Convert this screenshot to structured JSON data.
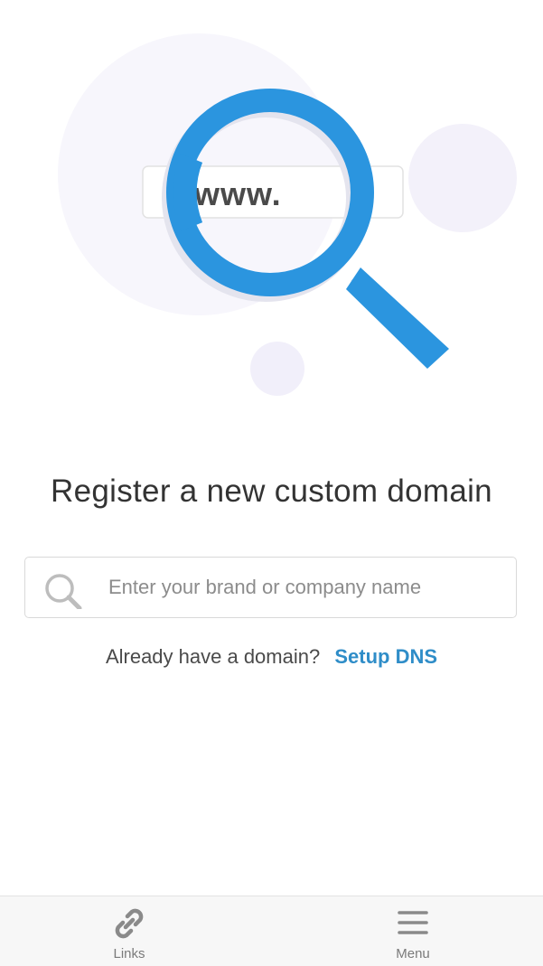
{
  "hero": {
    "url_text": "www.",
    "colors": {
      "magnifier": "#2b95df",
      "bubbles": "#f3f1fa"
    },
    "icon": "magnifier-illustration"
  },
  "main": {
    "title": "Register a new custom domain",
    "search": {
      "placeholder": "Enter your brand or company name",
      "value": "",
      "icon": "search-icon"
    },
    "dns_prompt": "Already have a domain?",
    "dns_link": "Setup DNS",
    "colors": {
      "link": "#2f8dc8"
    }
  },
  "bottom_nav": {
    "items": [
      {
        "label": "Links",
        "icon": "link-icon"
      },
      {
        "label": "Menu",
        "icon": "hamburger-menu-icon"
      }
    ]
  }
}
